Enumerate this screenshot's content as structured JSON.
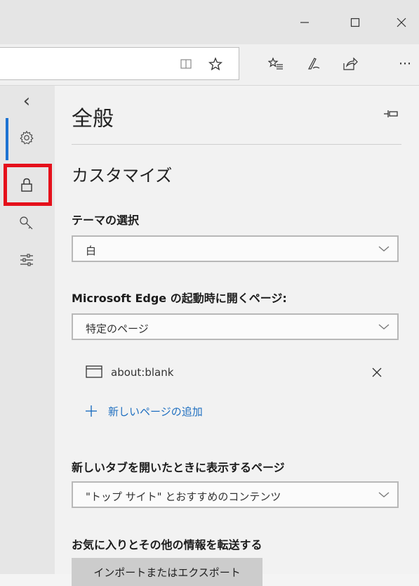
{
  "window": {
    "minimize_glyph": "—",
    "maximize_glyph": "☐",
    "close_glyph": "✕"
  },
  "toolbar": {
    "reading_view_icon": "reading-view-icon",
    "favorite_star_icon": "star-icon",
    "favorites_hub_icon": "favorites-list-icon",
    "notes_icon": "pen-icon",
    "share_icon": "share-icon",
    "more_glyph": "···"
  },
  "sidebar": {
    "back_glyph": "‹",
    "items": [
      {
        "icon": "gear-icon",
        "active": true
      },
      {
        "icon": "lock-icon",
        "highlighted": true
      },
      {
        "icon": "key-icon"
      },
      {
        "icon": "sliders-icon"
      }
    ],
    "accent_color": "#1e73d2",
    "highlight_color": "#e5101b"
  },
  "panel": {
    "title": "全般",
    "section_customize": "カスタマイズ",
    "theme_label": "テーマの選択",
    "theme_value": "白",
    "startup_label": "Microsoft Edge の起動時に開くページ:",
    "startup_value": "特定のページ",
    "page_url": "about:blank",
    "add_page_label": "新しいページの追加",
    "newtab_label": "新しいタブを開いたときに表示するページ",
    "newtab_value": "\"トップ サイト\" とおすすめのコンテンツ",
    "transfer_label": "お気に入りとその他の情報を転送する",
    "import_button": "インポートまたはエクスポート",
    "link_color": "#1f6fc0"
  }
}
